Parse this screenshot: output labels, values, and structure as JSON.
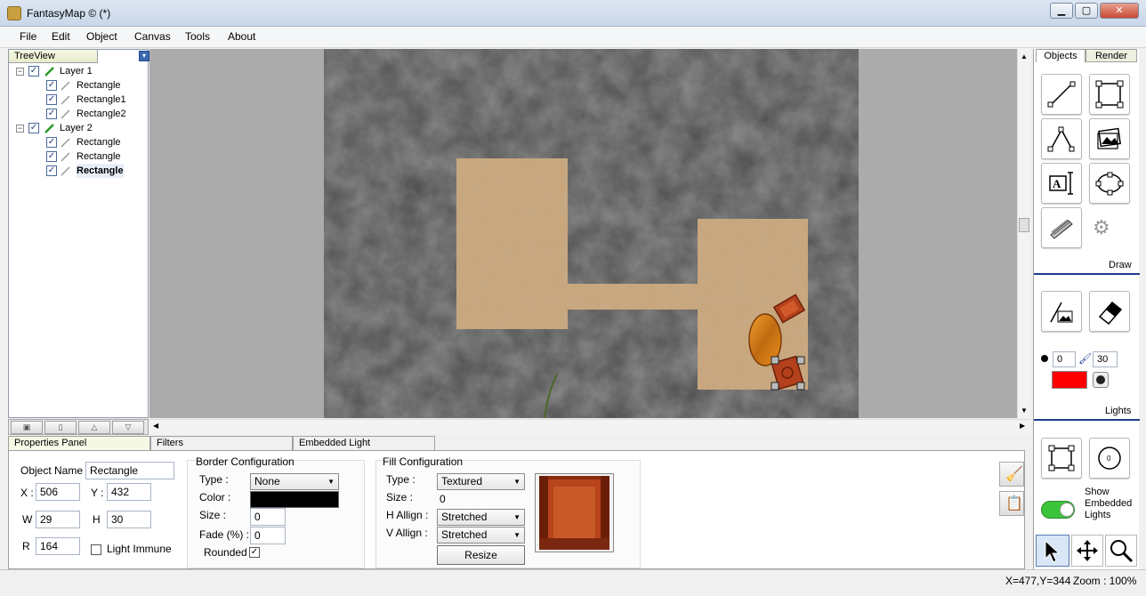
{
  "window": {
    "title": "FantasyMap © (*)"
  },
  "menu": [
    "File",
    "Edit",
    "Object",
    "Canvas",
    "Tools",
    "About"
  ],
  "treeview": {
    "title": "TreeView",
    "layers": [
      {
        "name": "Layer 1",
        "items": [
          "Rectangle",
          "Rectangle1",
          "Rectangle2"
        ]
      },
      {
        "name": "Layer 2",
        "items": [
          "Rectangle",
          "Rectangle",
          "Rectangle"
        ]
      }
    ]
  },
  "right_panel": {
    "tabs": [
      "Objects",
      "Render"
    ],
    "draw_label": "Draw",
    "lights_label": "Lights",
    "brush_size": "0",
    "brush_width": "30",
    "light_color": "#ff0000",
    "show_embedded_label": "Show Embedded Lights"
  },
  "bottom_tabs": [
    "Properties Panel",
    "Filters",
    "Embedded Light"
  ],
  "properties": {
    "object_name_label": "Object Name",
    "object_name": "Rectangle",
    "x_label": "X :",
    "x": "506",
    "y_label": "Y :",
    "y": "432",
    "w_label": "W",
    "w": "29",
    "h_label": "H",
    "h": "30",
    "r_label": "R",
    "r": "164",
    "light_immune_label": "Light Immune",
    "border": {
      "title": "Border Configuration",
      "type_label": "Type :",
      "type": "None",
      "color_label": "Color :",
      "color": "#000000",
      "size_label": "Size :",
      "size": "0",
      "fade_label": "Fade (%) :",
      "fade": "0",
      "rounded_label": "Rounded"
    },
    "fill": {
      "title": "Fill Configuration",
      "type_label": "Type :",
      "type": "Textured",
      "size_label": "Size :",
      "size": "0",
      "h_align_label": "H Allign :",
      "h_align": "Stretched",
      "v_align_label": "V Allign :",
      "v_align": "Stretched",
      "resize_label": "Resize"
    }
  },
  "status": {
    "coords": "X=477,Y=344",
    "zoom": "Zoom : 100%"
  }
}
